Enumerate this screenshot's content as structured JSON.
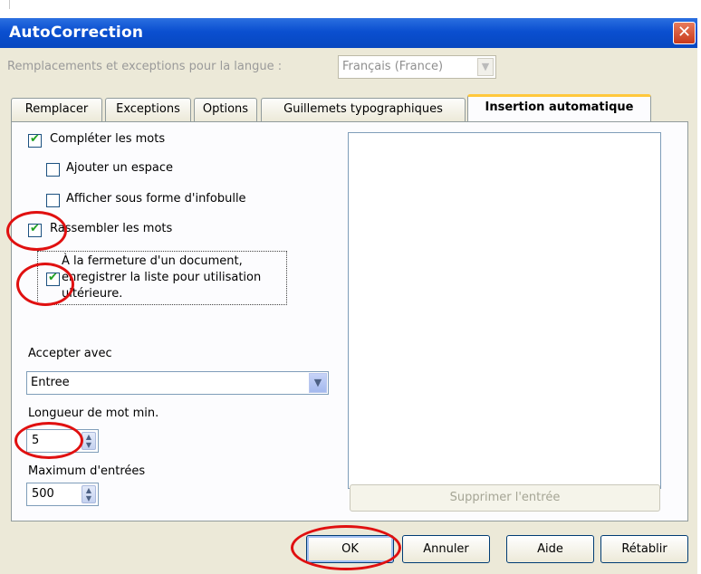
{
  "window": {
    "title": "AutoCorrection",
    "close_glyph": "✕"
  },
  "language": {
    "label": "Remplacements et exceptions pour la langue :",
    "value": "Français (France)"
  },
  "tabs": [
    {
      "label": "Remplacer"
    },
    {
      "label": "Exceptions"
    },
    {
      "label": "Options"
    },
    {
      "label": "Guillemets typographiques"
    },
    {
      "label": "Insertion automatique",
      "active": true
    }
  ],
  "options": {
    "complete_words": {
      "label": "Compléter les mots",
      "checked": true
    },
    "add_space": {
      "label": "Ajouter un espace",
      "checked": false
    },
    "show_tooltip": {
      "label": "Afficher sous forme d'infobulle",
      "checked": false
    },
    "collect_words": {
      "label": "Rassembler les mots",
      "checked": true
    },
    "save_list": {
      "line1": "À la fermeture d'un document,",
      "line2": "enregistrer la liste pour utilisation",
      "line3": "ultérieure.",
      "checked": true
    }
  },
  "accept": {
    "label": "Accepter avec",
    "value": "Entree"
  },
  "min_length": {
    "label": "Longueur de mot min.",
    "value": "5"
  },
  "max_entries": {
    "label": "Maximum d'entrées",
    "value": "500"
  },
  "word_list": {
    "delete_button": "Supprimer l'entrée"
  },
  "buttons": {
    "ok": "OK",
    "cancel": "Annuler",
    "help": "Aide",
    "reset": "Rétablir"
  },
  "colors": {
    "annotation_circle": "#e01010",
    "title_bar": "#0a4fd0",
    "active_tab_accent": "#ffc83c",
    "checkmark": "#21a121"
  }
}
